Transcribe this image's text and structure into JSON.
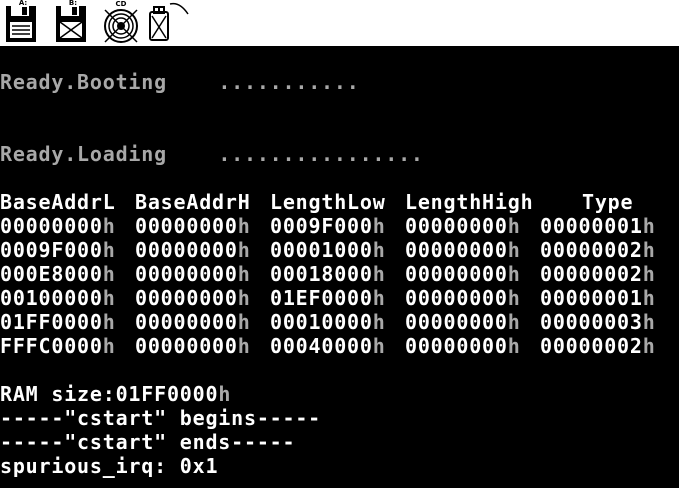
{
  "toolbar": {
    "devices": [
      {
        "label": "A:",
        "icon": "floppy-a-icon"
      },
      {
        "label": "B:",
        "icon": "floppy-b-icon"
      },
      {
        "label": "CD",
        "icon": "cdrom-icon"
      },
      {
        "label": "",
        "icon": "usb-icon"
      }
    ]
  },
  "console": {
    "booting": {
      "label": "Booting",
      "dots": "..........."
    },
    "ready_1": "Ready.",
    "loading": {
      "label": "Loading",
      "dots": "................"
    },
    "ready_2": "Ready.",
    "memory_table": {
      "headers": [
        "BaseAddrL",
        "BaseAddrH",
        "LengthLow",
        "LengthHigh",
        "Type"
      ],
      "rows": [
        [
          "00000000",
          "00000000",
          "0009F000",
          "00000000",
          "00000001"
        ],
        [
          "0009F000",
          "00000000",
          "00001000",
          "00000000",
          "00000002"
        ],
        [
          "000E8000",
          "00000000",
          "00018000",
          "00000000",
          "00000002"
        ],
        [
          "00100000",
          "00000000",
          "01EF0000",
          "00000000",
          "00000001"
        ],
        [
          "01FF0000",
          "00000000",
          "00010000",
          "00000000",
          "00000003"
        ],
        [
          "FFFC0000",
          "00000000",
          "00040000",
          "00000000",
          "00000002"
        ]
      ],
      "suffix": "h"
    },
    "ram_size": {
      "label": "RAM size:",
      "value": "01FF0000",
      "suffix": "h"
    },
    "cstart_begins": "-----\"cstart\" begins-----",
    "cstart_ends": "-----\"cstart\" ends-----",
    "spurious_irq": "spurious_irq: 0x1"
  },
  "colors": {
    "screen_bg": "#000000",
    "gray_text": "#a8a8a8",
    "white_text": "#ffffff",
    "toolbar_bg": "#ffffff"
  }
}
